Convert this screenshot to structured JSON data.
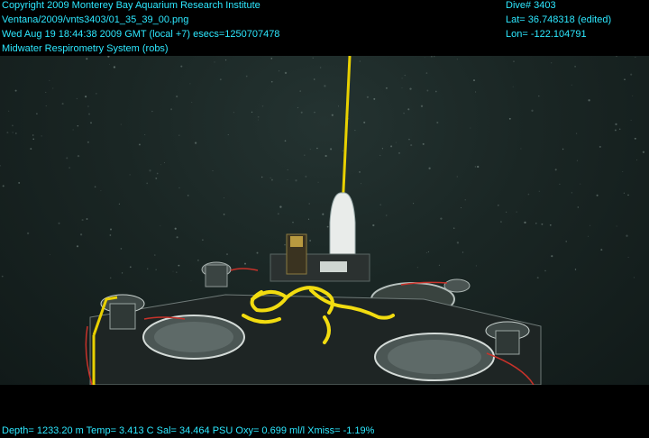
{
  "overlay": {
    "copyright": "Copyright 2009 Monterey Bay Aquarium Research Institute",
    "file_path": "Ventana/2009/vnts3403/01_35_39_00.png",
    "datetime": "Wed Aug 19 18:44:38 2009 GMT (local +7)  esecs=1250707478",
    "system": "Midwater Respirometry System (robs)",
    "dive": "Dive# 3403",
    "lat": "Lat= 36.748318 (edited)",
    "lon": "Lon= -122.104791",
    "telemetry": "Depth= 1233.20 m  Temp= 3.413 C  Sal= 34.464 PSU  Oxy= 0.699 ml/l  Xmiss= -1.19%"
  },
  "colors": {
    "overlay_text": "#2de8ff",
    "water": "#1a2624",
    "tether": "#e8d000",
    "rope": "#f2dc10"
  }
}
